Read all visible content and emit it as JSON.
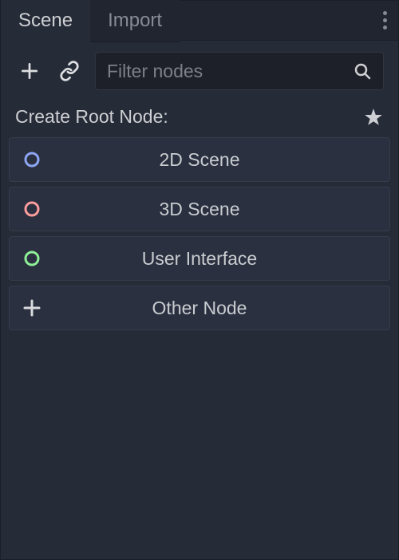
{
  "tabs": {
    "scene": "Scene",
    "import": "Import"
  },
  "search": {
    "placeholder": "Filter nodes"
  },
  "section": {
    "title": "Create Root Node:"
  },
  "nodes": {
    "node2d": {
      "label": "2D Scene",
      "color": "#8DA5F3"
    },
    "node3d": {
      "label": "3D Scene",
      "color": "#FC9C9C"
    },
    "ui": {
      "label": "User Interface",
      "color": "#8EEF97"
    },
    "other": {
      "label": "Other Node",
      "color": "#D8DADE"
    }
  }
}
